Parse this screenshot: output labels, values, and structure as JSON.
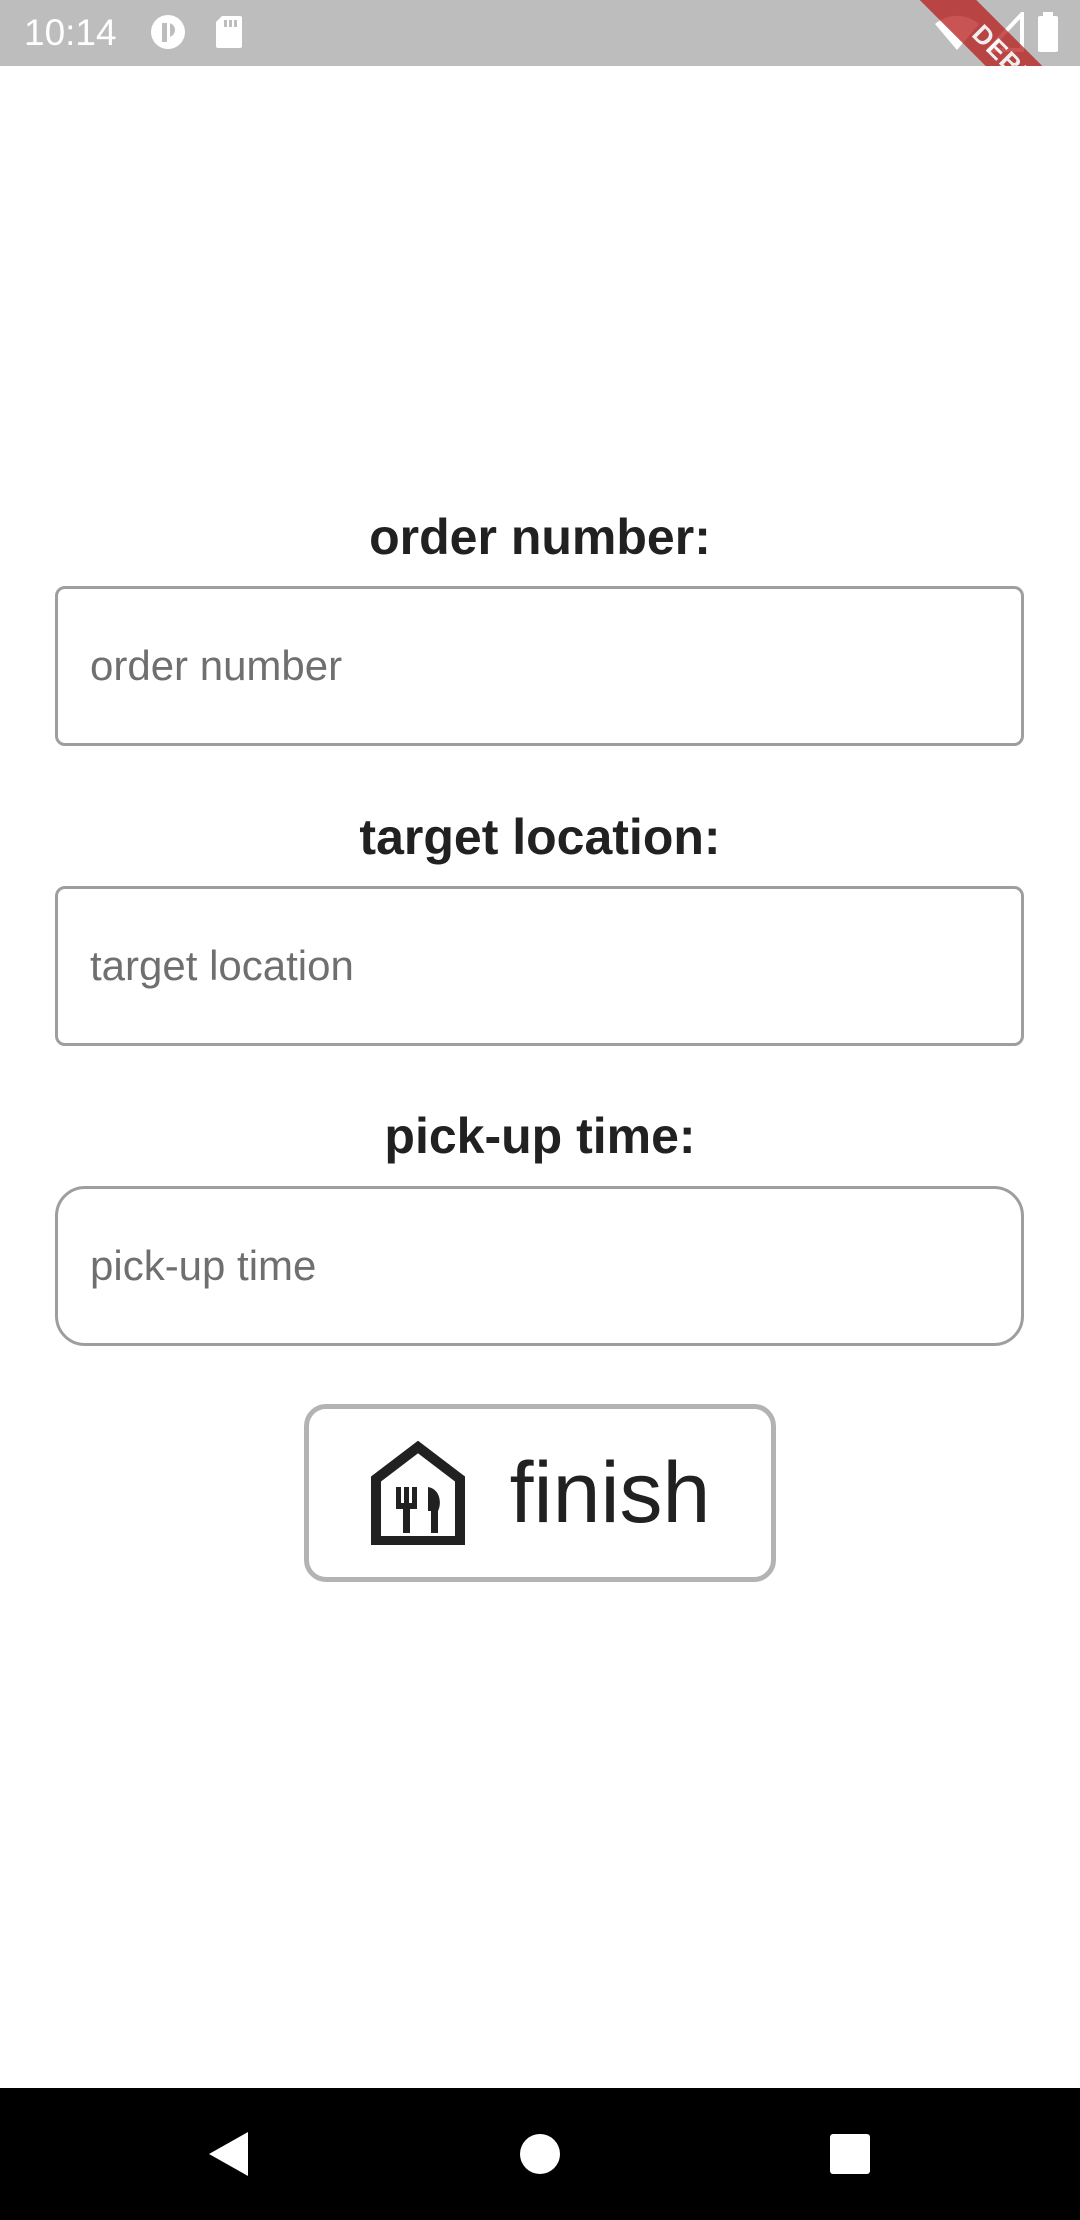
{
  "status_bar": {
    "time": "10:14",
    "debug_label": "DEBUG"
  },
  "form": {
    "order_number": {
      "label": "order number:",
      "placeholder": "order number",
      "value": ""
    },
    "target_location": {
      "label": "target location:",
      "placeholder": "target location",
      "value": ""
    },
    "pickup_time": {
      "label": "pick-up time:",
      "placeholder": "pick-up time",
      "value": ""
    }
  },
  "finish_button": {
    "label": "finish",
    "icon": "restaurant-house-icon"
  },
  "nav_bar": {
    "back_icon": "back-triangle-icon",
    "home_icon": "home-circle-icon",
    "recents_icon": "recents-square-icon"
  },
  "colors": {
    "status_bar_bg": "#bdbdbd",
    "debug_banner": "#b71c1c",
    "field_border": "#9e9e9e",
    "button_border": "#b3b3b3",
    "text": "#212121",
    "nav_bar_bg": "#000000"
  }
}
